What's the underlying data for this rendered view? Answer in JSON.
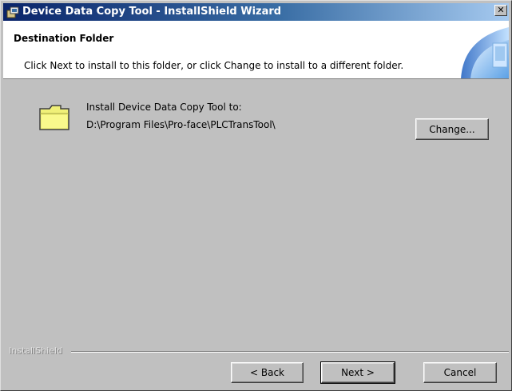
{
  "window": {
    "title": "Device Data Copy Tool - InstallShield Wizard",
    "close_glyph": "✕"
  },
  "header": {
    "title": "Destination Folder",
    "description": "Click Next to install to this folder, or click Change to install to a different folder."
  },
  "install": {
    "label": "Install Device Data Copy Tool to:",
    "path": "D:\\Program Files\\Pro-face\\PLCTransTool\\",
    "change_button": "Change..."
  },
  "footer": {
    "brand": "InstallShield",
    "back_button": "< Back",
    "next_button": "Next >",
    "cancel_button": "Cancel"
  },
  "colors": {
    "title_bar_start": "#0a246a",
    "title_bar_end": "#a6caf0",
    "dialog_face": "#c0c0c0"
  },
  "icons": {
    "title": "installer-icon",
    "folder": "folder-icon"
  }
}
